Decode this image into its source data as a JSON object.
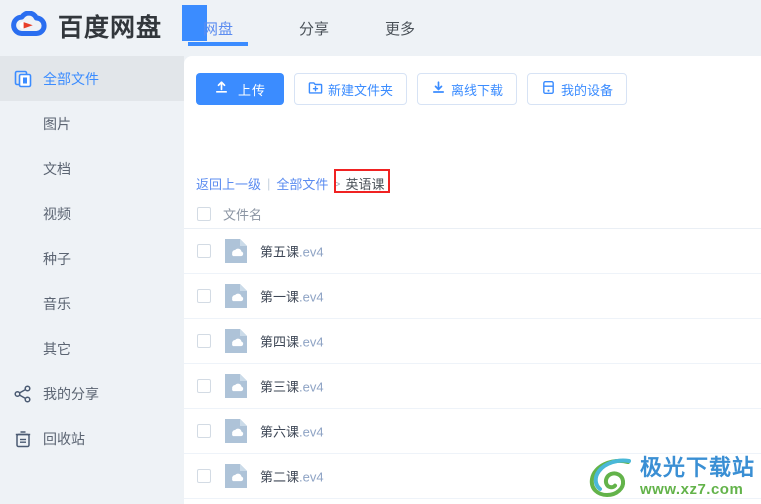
{
  "app": {
    "brand_name": "百度网盘",
    "brand_logo_icon": "baidu-cloud-logo"
  },
  "header": {
    "tabs": [
      {
        "label": "网盘",
        "active": true
      },
      {
        "label": "分享",
        "active": false
      },
      {
        "label": "更多",
        "active": false
      }
    ]
  },
  "sidebar": {
    "items": [
      {
        "label": "全部文件",
        "icon": "files-stack-icon",
        "active": true,
        "sub": false
      },
      {
        "label": "图片",
        "icon": "",
        "active": false,
        "sub": true
      },
      {
        "label": "文档",
        "icon": "",
        "active": false,
        "sub": true
      },
      {
        "label": "视频",
        "icon": "",
        "active": false,
        "sub": true
      },
      {
        "label": "种子",
        "icon": "",
        "active": false,
        "sub": true
      },
      {
        "label": "音乐",
        "icon": "",
        "active": false,
        "sub": true
      },
      {
        "label": "其它",
        "icon": "",
        "active": false,
        "sub": true
      },
      {
        "label": "我的分享",
        "icon": "share-nodes-icon",
        "active": false,
        "sub": false
      },
      {
        "label": "回收站",
        "icon": "trash-bin-icon",
        "active": false,
        "sub": false
      }
    ]
  },
  "toolbar": {
    "buttons": [
      {
        "label": "上传",
        "icon": "upload-icon",
        "style": "primary"
      },
      {
        "label": "新建文件夹",
        "icon": "folder-plus-icon",
        "style": "outline"
      },
      {
        "label": "离线下载",
        "icon": "download-icon",
        "style": "outline"
      },
      {
        "label": "我的设备",
        "icon": "device-icon",
        "style": "outline"
      }
    ]
  },
  "breadcrumb": {
    "back_label": "返回上一级",
    "divider": "|",
    "root_label": "全部文件",
    "separator": ">",
    "current_label": "英语课",
    "highlight_color": "#f02222"
  },
  "file_table": {
    "header": {
      "name_column": "文件名"
    },
    "rows": [
      {
        "name": "第五课",
        "ext": ".ev4",
        "icon": "cloud-file-icon",
        "checked": false
      },
      {
        "name": "第一课",
        "ext": ".ev4",
        "icon": "cloud-file-icon",
        "checked": false
      },
      {
        "name": "第四课",
        "ext": ".ev4",
        "icon": "cloud-file-icon",
        "checked": false
      },
      {
        "name": "第三课",
        "ext": ".ev4",
        "icon": "cloud-file-icon",
        "checked": false
      },
      {
        "name": "第六课",
        "ext": ".ev4",
        "icon": "cloud-file-icon",
        "checked": false
      },
      {
        "name": "第二课",
        "ext": ".ev4",
        "icon": "cloud-file-icon",
        "checked": false
      }
    ]
  },
  "watermark": {
    "title": "极光下载站",
    "url": "www.xz7.com",
    "logo_icon": "aurora-swirl-logo"
  },
  "colors": {
    "accent_blue": "#3b8cff",
    "page_bg": "#eef2f6",
    "panel_bg": "#ffffff",
    "sidebar_active_bg": "#e2e6ea",
    "annotation_red": "#f02222"
  }
}
